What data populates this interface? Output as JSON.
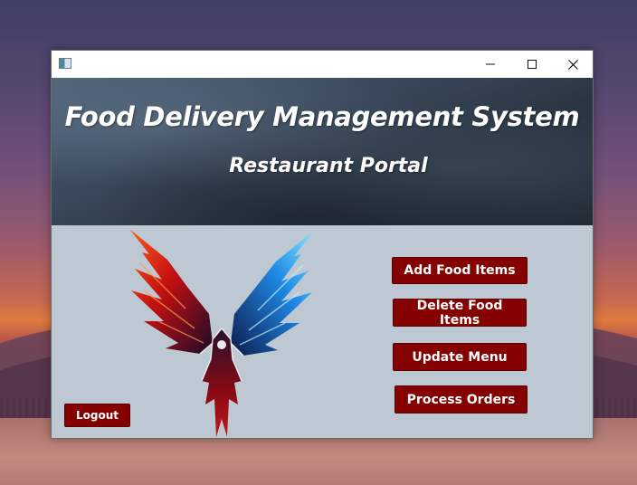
{
  "window": {
    "title": "",
    "app_icon": "window-app-icon",
    "controls": {
      "minimize_icon": "minimize-icon",
      "maximize_icon": "maximize-icon",
      "close_icon": "close-icon"
    }
  },
  "header": {
    "title": "Food Delivery Management System",
    "subtitle": "Restaurant Portal"
  },
  "logo": {
    "icon": "phoenix-logo"
  },
  "actions": {
    "add_food_items": "Add Food Items",
    "delete_food_items": "Delete Food Items",
    "update_menu": "Update Menu",
    "process_orders": "Process Orders",
    "logout": "Logout"
  },
  "colors": {
    "button_bg": "#850000",
    "content_bg": "#bec8d2",
    "header_dark": "#2a3542"
  }
}
